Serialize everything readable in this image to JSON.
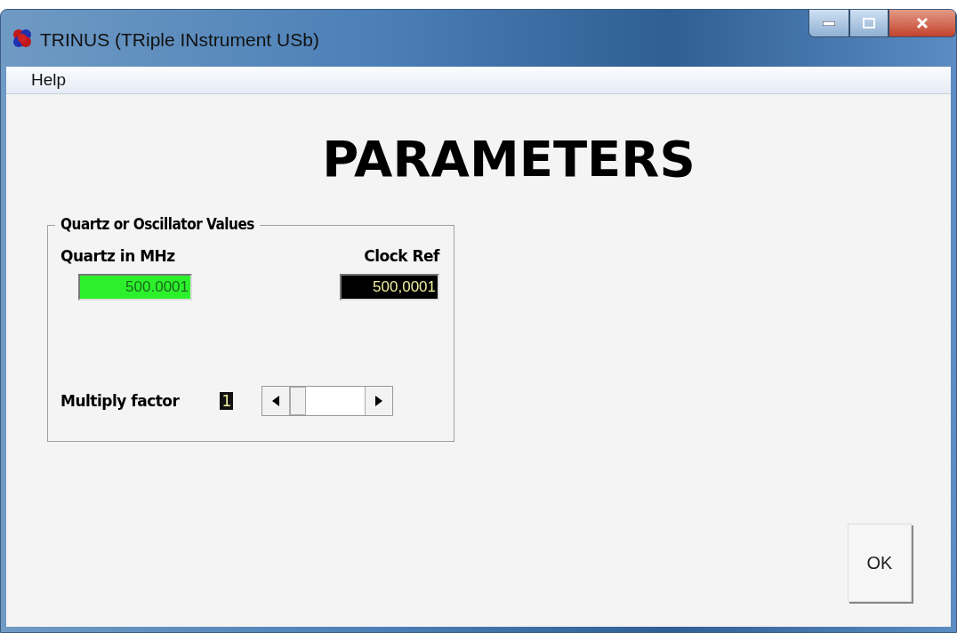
{
  "window": {
    "title": "TRINUS (TRiple INstrument USb)"
  },
  "menu": [
    {
      "label": "Help"
    }
  ],
  "heading": "PARAMETERS",
  "group": {
    "title": "Quartz or Oscillator Values",
    "quartz": {
      "label": "Quartz in MHz",
      "value": "500.0001"
    },
    "clock_ref": {
      "label": "Clock Ref",
      "value": "500,0001"
    },
    "multiply": {
      "label": "Multiply factor",
      "value": "1"
    }
  },
  "buttons": [
    {
      "label": "OK"
    }
  ]
}
